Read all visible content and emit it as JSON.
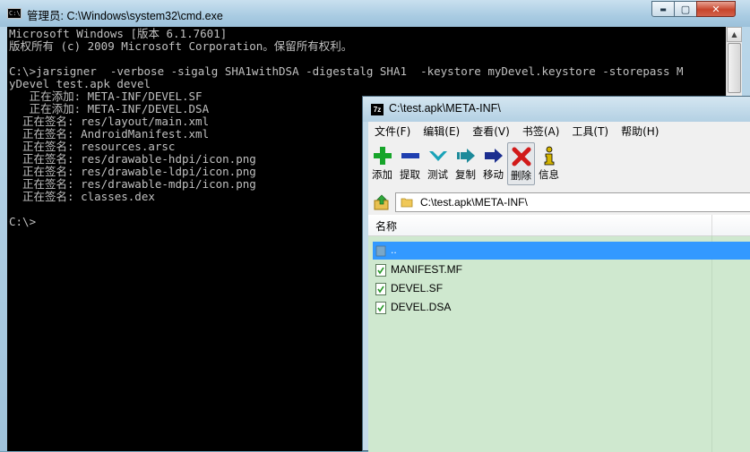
{
  "cmd": {
    "title": "管理员: C:\\Windows\\system32\\cmd.exe",
    "icon_text": "C:\\",
    "controls": {
      "minimize": "▬",
      "maximize": "▢",
      "close": "✕"
    },
    "lines": [
      "Microsoft Windows [版本 6.1.7601]",
      "版权所有 (c) 2009 Microsoft Corporation。保留所有权利。",
      "",
      "C:\\>jarsigner  -verbose -sigalg SHA1withDSA -digestalg SHA1  -keystore myDevel.keystore -storepass M",
      "yDevel test.apk devel",
      "   正在添加: META-INF/DEVEL.SF",
      "   正在添加: META-INF/DEVEL.DSA",
      "  正在签名: res/layout/main.xml",
      "  正在签名: AndroidManifest.xml",
      "  正在签名: resources.arsc",
      "  正在签名: res/drawable-hdpi/icon.png",
      "  正在签名: res/drawable-ldpi/icon.png",
      "  正在签名: res/drawable-mdpi/icon.png",
      "  正在签名: classes.dex",
      "",
      "C:\\>"
    ]
  },
  "zip": {
    "icon_text": "7z",
    "title": "C:\\test.apk\\META-INF\\",
    "menu": [
      "文件(F)",
      "编辑(E)",
      "查看(V)",
      "书签(A)",
      "工具(T)",
      "帮助(H)"
    ],
    "toolbar": [
      {
        "label": "添加",
        "icon": "add-icon",
        "color": "#17a52a"
      },
      {
        "label": "提取",
        "icon": "extract-icon",
        "color": "#1f3fb0"
      },
      {
        "label": "测试",
        "icon": "test-icon",
        "color": "#1aa3b8"
      },
      {
        "label": "复制",
        "icon": "copy-icon",
        "color": "#1c8a9a"
      },
      {
        "label": "移动",
        "icon": "move-icon",
        "color": "#1b2e8f"
      },
      {
        "label": "删除",
        "icon": "delete-icon",
        "color": "#d11a1a"
      },
      {
        "label": "信息",
        "icon": "info-icon",
        "color": "#d4b400"
      }
    ],
    "path": "C:\\test.apk\\META-INF\\",
    "columns": {
      "name": "名称"
    },
    "files": [
      {
        "name": "..",
        "icon": "parent-folder-icon",
        "selected": true
      },
      {
        "name": "MANIFEST.MF",
        "icon": "file-icon",
        "selected": false
      },
      {
        "name": "DEVEL.SF",
        "icon": "file-icon",
        "selected": false
      },
      {
        "name": "DEVEL.DSA",
        "icon": "file-icon",
        "selected": false
      }
    ],
    "colors": {
      "list_background": "#cfe8cf",
      "selection": "#3399ff"
    }
  }
}
